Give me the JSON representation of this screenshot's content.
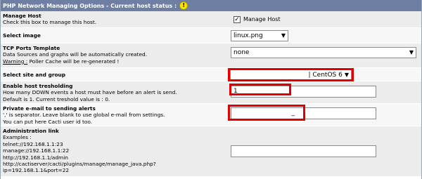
{
  "header": {
    "title": "PHP Network Managing Options - Current host status :",
    "status_icon": "warning-icon",
    "status_icon_glyph": "!"
  },
  "manage_host": {
    "title": "Manage Host",
    "description": "Check this box to manage this host.",
    "checkbox_label": "Manage Host",
    "checked": true,
    "check_glyph": "✓"
  },
  "select_image": {
    "title": "Select image",
    "value": "linux.png"
  },
  "tcp_ports": {
    "title": "TCP Ports Template",
    "description": "Data Sources and graphs will be automatically created.",
    "warning_word": "Warning :",
    "warning_text": " Poller Cache will be re-generated !",
    "value": "none"
  },
  "site_group": {
    "title": "Select site and group",
    "value": "| CentOS 6"
  },
  "threshold": {
    "title": "Enable host tresholding",
    "description1": "How many DOWN events a host must have before an alert is send.",
    "description2": "Default is 1. Current treshold value is : 0.",
    "value": "1"
  },
  "email": {
    "title": "Private e-mail to sending alerts",
    "description1": "',' is separator. Leave blank to use global e-mail from settings.",
    "description2": "You can put here Cacti user id too.",
    "value": "_"
  },
  "admin_link": {
    "title": "Administration link",
    "lines": [
      "Examples :",
      "telnet://192.168.1.1:23",
      "manage://192.168.1.1:22",
      "http://192.168.1.1/admin",
      "http://cactiserver/cacti/plugins/manage/manage_java.php?",
      "ip=192.168.1.1&port=22"
    ],
    "value": ""
  },
  "colors": {
    "header_bg": "#6e7fa3",
    "highlight_red": "#e00000",
    "row_alt": "#ececec"
  }
}
